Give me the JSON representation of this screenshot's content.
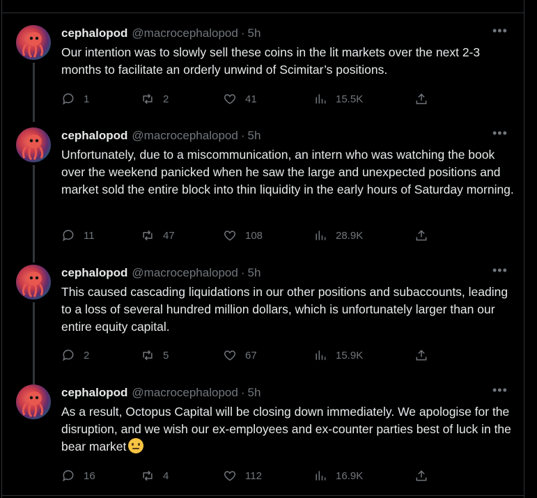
{
  "tweets": [
    {
      "name": "cephalopod",
      "handle": "@macrocephalopod",
      "time": "5h",
      "text": "Our intention was to slowly sell these coins in the lit markets over the next 2-3 months to facilitate an orderly unwind of Scimitar’s positions.",
      "replies": "1",
      "retweets": "2",
      "likes": "41",
      "views": "15.5K"
    },
    {
      "name": "cephalopod",
      "handle": "@macrocephalopod",
      "time": "5h",
      "text": "Unfortunately, due to a miscommunication, an intern who was watching the book over the weekend panicked when he saw the large and unexpected positions and market sold the entire block into thin liquidity in the early hours of Saturday morning.",
      "replies": "11",
      "retweets": "47",
      "likes": "108",
      "views": "28.9K"
    },
    {
      "name": "cephalopod",
      "handle": "@macrocephalopod",
      "time": "5h",
      "text": "This caused cascading liquidations in our other positions and subaccounts, leading to a loss of several hundred million dollars, which is unfortunately larger than our entire equity capital.",
      "replies": "2",
      "retweets": "5",
      "likes": "67",
      "views": "15.9K"
    },
    {
      "name": "cephalopod",
      "handle": "@macrocephalopod",
      "time": "5h",
      "text": "As a result, Octopus Capital will be closing down immediately. We apologise for the disruption, and we wish our ex-employees and ex-counter parties best of luck in the bear market",
      "emoji": "salute-emoji",
      "replies": "16",
      "retweets": "4",
      "likes": "112",
      "views": "16.9K"
    }
  ],
  "separator": "·",
  "more_icon": "more-horizontal-icon",
  "colors": {
    "background": "#000000",
    "text_primary": "#e7e9ea",
    "text_secondary": "#71767b",
    "border": "#2f3336"
  }
}
